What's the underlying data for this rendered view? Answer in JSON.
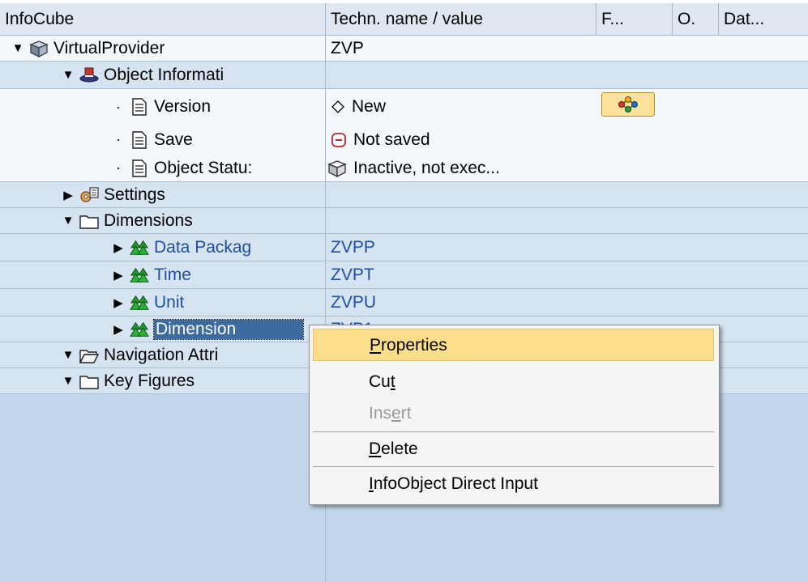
{
  "header": {
    "col1": "InfoCube",
    "col2": "Techn. name / value",
    "col3": "F...",
    "col4": "O.",
    "col5": "Dat..."
  },
  "tree": {
    "virtual_provider": {
      "label": "VirtualProvider",
      "value": "ZVP"
    },
    "object_info": {
      "label": "Object Informati"
    },
    "version": {
      "label": "Version",
      "value": "New"
    },
    "save": {
      "label": "Save",
      "value": "Not saved"
    },
    "object_status": {
      "label": "Object Statu:",
      "value": "Inactive, not exec..."
    },
    "settings": {
      "label": "Settings"
    },
    "dimensions": {
      "label": "Dimensions"
    },
    "dim_items": [
      {
        "label": "Data Packag",
        "value": "ZVPP"
      },
      {
        "label": "Time",
        "value": "ZVPT"
      },
      {
        "label": "Unit",
        "value": "ZVPU"
      },
      {
        "label": "Dimension",
        "value": "ZVP1"
      }
    ],
    "nav_attr": {
      "label": "Navigation Attri"
    },
    "key_figures": {
      "label": "Key Figures"
    }
  },
  "context_menu": {
    "properties": {
      "pre": "",
      "u": "P",
      "post": "roperties"
    },
    "cut": {
      "pre": "Cu",
      "u": "t",
      "post": ""
    },
    "insert": {
      "pre": "Ins",
      "u": "e",
      "post": "rt"
    },
    "delete": {
      "pre": "",
      "u": "D",
      "post": "elete"
    },
    "direct_input": {
      "pre": "",
      "u": "I",
      "post": "nfoObject Direct Input"
    }
  },
  "colors": {
    "background": "#c2d6ea",
    "row_white": "#f4f7fb",
    "row_blue": "#d6e3f0",
    "link": "#1f4fa0",
    "menu_highlight": "#fbdd8a",
    "selection": "#3d6b9e"
  },
  "icons": {
    "virtual_provider": "cube-icon",
    "object_info": "hat-icon",
    "document": "document-icon",
    "settings": "settings-icon",
    "folder": "folder-icon",
    "dimension": "tree-icon"
  }
}
